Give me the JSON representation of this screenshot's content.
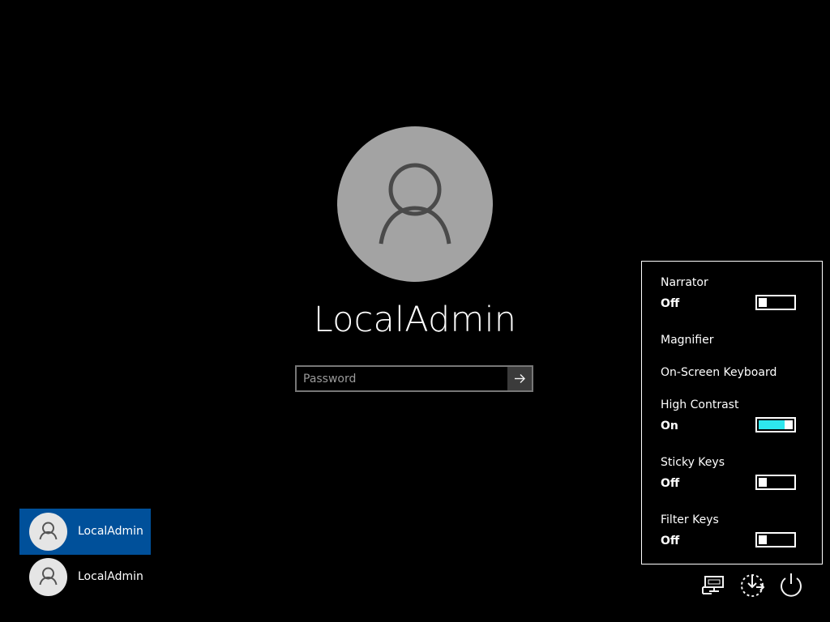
{
  "user": {
    "name": "LocalAdmin"
  },
  "password": {
    "placeholder": "Password",
    "value": ""
  },
  "accounts": [
    {
      "label": "LocalAdmin",
      "selected": true
    },
    {
      "label": "LocalAdmin",
      "selected": false
    }
  ],
  "ease_of_access": {
    "narrator": {
      "label": "Narrator",
      "state": "Off",
      "toggle_level": 0
    },
    "magnifier": {
      "label": "Magnifier"
    },
    "on_screen_keyboard": {
      "label": "On-Screen Keyboard"
    },
    "high_contrast": {
      "label": "High Contrast",
      "state": "On",
      "toggle_level": 1
    },
    "sticky_keys": {
      "label": "Sticky Keys",
      "state": "Off",
      "toggle_level": 0
    },
    "filter_keys": {
      "label": "Filter Keys",
      "state": "Off",
      "toggle_level": 0
    }
  },
  "bottom_actions": [
    {
      "icon": "network-icon"
    },
    {
      "icon": "ease-of-access-icon"
    },
    {
      "icon": "power-icon"
    }
  ],
  "colors": {
    "background": "#000000",
    "avatar_gray": "#a3a3a3",
    "tile_avatar_gray": "#e5e5e5",
    "selected_account": "#00509a",
    "password_border": "#777777",
    "submit_button": "#3b3b3b",
    "toggle_accent": "#2ee6ee"
  }
}
